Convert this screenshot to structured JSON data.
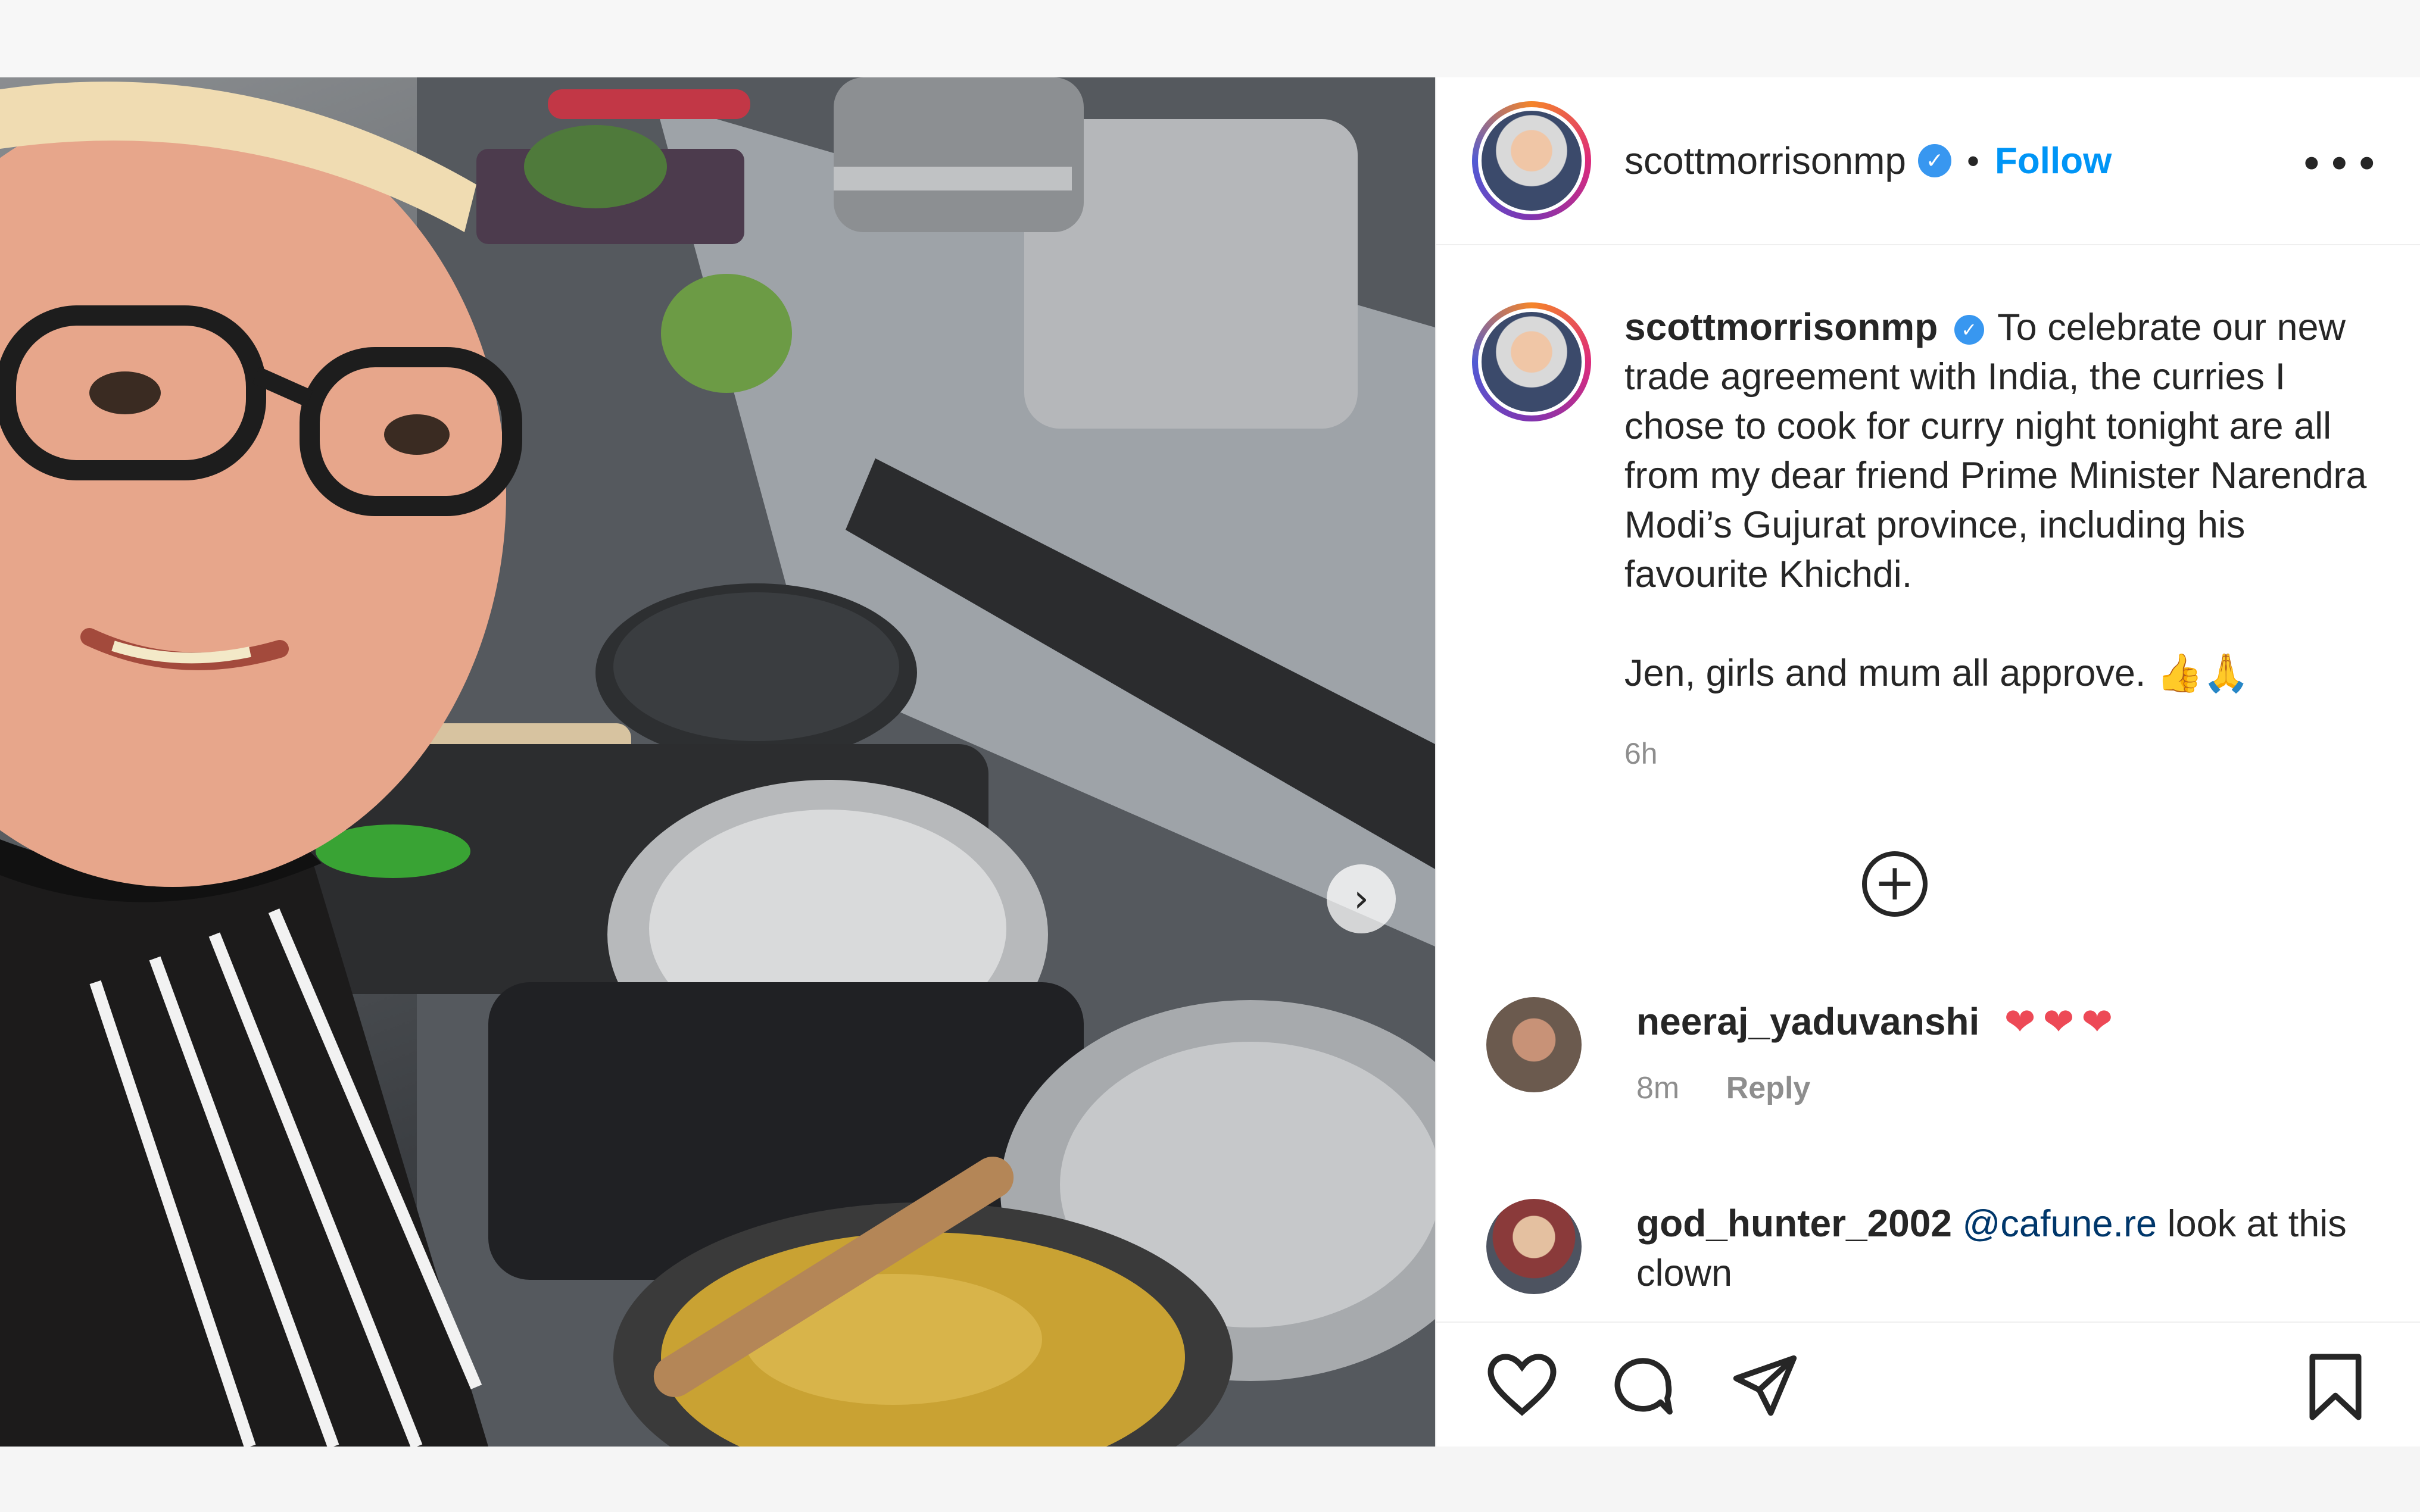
{
  "post": {
    "author": {
      "username": "scottmorrisonmp",
      "verified": true,
      "follow_label": "Follow",
      "separator": "•",
      "more_label": "•••"
    },
    "media": {
      "next_arrow": "›",
      "icon": "chevron-right-icon"
    },
    "caption": {
      "username": "scottmorrisonmp",
      "text": "To celebrate our new trade agreement with India, the curries I chose to cook for curry night tonight are all from my dear friend Prime Minister Narendra Modi’s Gujurat province, including his favourite Khichdi.",
      "text2": "Jen, girls and mum all approve.",
      "emoji": "👍🙏",
      "time": "6h"
    },
    "load_more": {
      "label": "+",
      "icon": "plus-circle-icon"
    },
    "comments": [
      {
        "username": "neeraj_yaduvanshi",
        "text": "❤❤❤",
        "time": "8m",
        "reply_label": "Reply"
      },
      {
        "username": "god_hunter_2002",
        "mention": "@cafune.re",
        "text": "look at this clown"
      }
    ],
    "actions": [
      "heart-icon",
      "comment-icon",
      "share-icon",
      "bookmark-icon"
    ]
  },
  "colors": {
    "link_blue": "#0095f6",
    "verified_blue": "#3897f0",
    "heart_red": "#ed4956",
    "text": "#262626",
    "muted": "#8e8e8e"
  }
}
